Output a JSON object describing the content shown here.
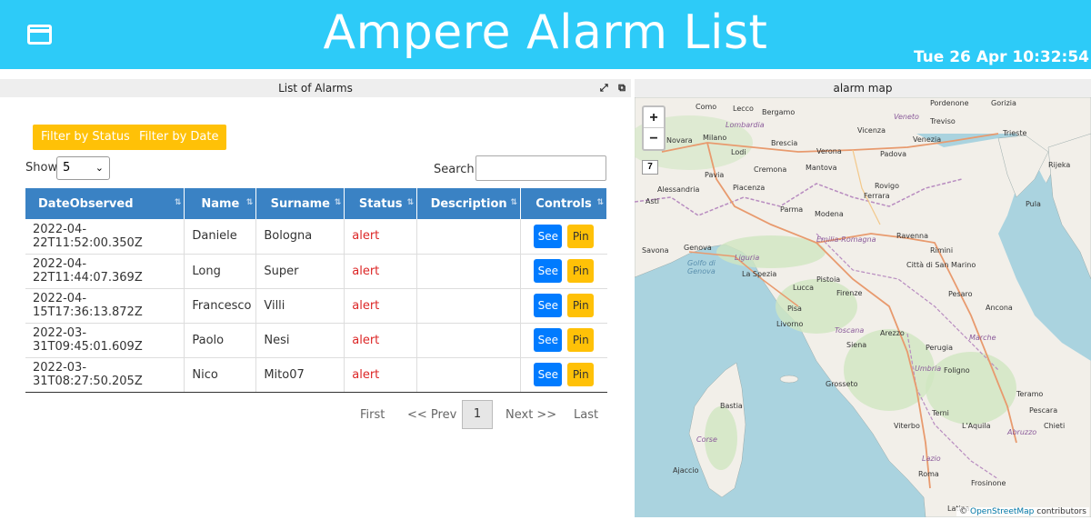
{
  "header": {
    "title": "Ampere Alarm List",
    "clock": "Tue 26 Apr 10:32:54",
    "menu_icon": "window-icon"
  },
  "left_panel": {
    "title": "List of Alarms",
    "icons": [
      "expand-icon",
      "external-link-icon"
    ],
    "filter_status_label": "Filter by Status",
    "filter_date_label": "Filter by Date",
    "show_label": "Show",
    "show_value": "5",
    "search_label": "Search:",
    "columns": [
      "DateObserved",
      "Name",
      "Surname",
      "Status",
      "Description",
      "Controls"
    ],
    "rows": [
      {
        "date": "2022-04-22T11:52:00.350Z",
        "name": "Daniele",
        "surname": "Bologna",
        "status": "alert",
        "description": "",
        "see": "See",
        "pin": "Pin"
      },
      {
        "date": "2022-04-22T11:44:07.369Z",
        "name": "Long",
        "surname": "Super",
        "status": "alert",
        "description": "",
        "see": "See",
        "pin": "Pin"
      },
      {
        "date": "2022-04-15T17:36:13.872Z",
        "name": "Francesco",
        "surname": "Villi",
        "status": "alert",
        "description": "",
        "see": "See",
        "pin": "Pin"
      },
      {
        "date": "2022-03-31T09:45:01.609Z",
        "name": "Paolo",
        "surname": "Nesi",
        "status": "alert",
        "description": "",
        "see": "See",
        "pin": "Pin"
      },
      {
        "date": "2022-03-31T08:27:50.205Z",
        "name": "Nico",
        "surname": "Mito07",
        "status": "alert",
        "description": "",
        "see": "See",
        "pin": "Pin"
      }
    ],
    "pager": {
      "first": "First",
      "prev": "<< Prev",
      "page": "1",
      "next": "Next >>",
      "last": "Last"
    }
  },
  "right_panel": {
    "title": "alarm map",
    "zoom_in": "+",
    "zoom_out": "−",
    "layer_btn": "7",
    "attribution_prefix": "©",
    "attribution_link": "OpenStreetMap",
    "attribution_suffix": "contributors",
    "cities": [
      "Como",
      "Lecco",
      "Bergamo",
      "Verona",
      "Vicenza",
      "Pordenone",
      "Gorizia",
      "Trieste",
      "Novara",
      "Milano",
      "Brescia",
      "Padova",
      "Venezia",
      "Lodi",
      "Cremona",
      "Mantova",
      "Pavia",
      "Rovigo",
      "Ferrara",
      "Alessandria",
      "Piacenza",
      "Parma",
      "Modena",
      "Asti",
      "Ravenna",
      "Savona",
      "Genova",
      "Pula",
      "Rijeka",
      "La Spezia",
      "Pistoia",
      "Lucca",
      "Firenze",
      "Città di San Marino",
      "Pesaro",
      "Pisa",
      "Livorno",
      "Ancona",
      "Arezzo",
      "Siena",
      "Perugia",
      "Grosseto",
      "Teramo",
      "Pescara",
      "Chieti",
      "Terni",
      "L'Aquila",
      "Viterbo",
      "Bastia",
      "Ajaccio",
      "Roma",
      "Frosinone",
      "Latina",
      "Treviso",
      "Rimini",
      "Foligno"
    ],
    "regions": [
      "Lombardia",
      "Veneto",
      "Emilia-Romagna",
      "Liguria",
      "Toscana",
      "Marche",
      "Umbria",
      "Abruzzo",
      "Lazio",
      "Corse",
      "Golfo di Genova"
    ]
  }
}
